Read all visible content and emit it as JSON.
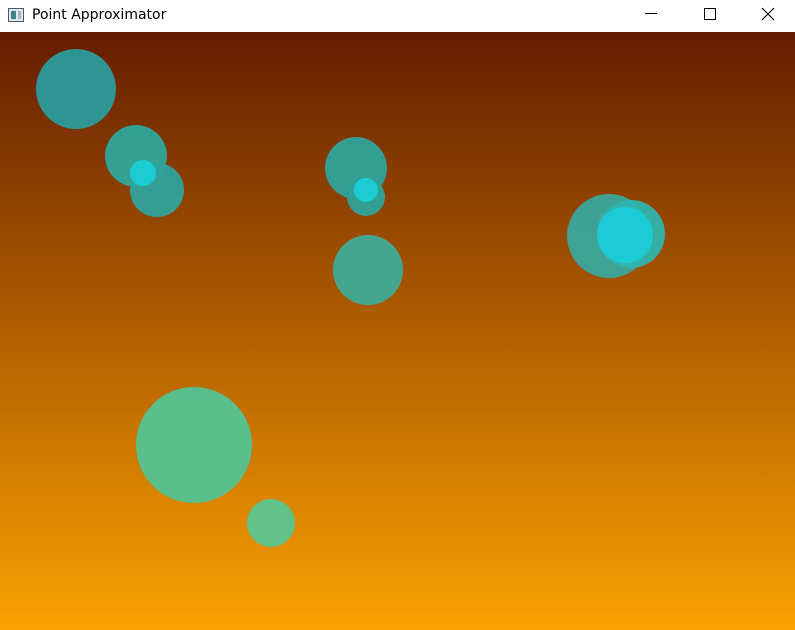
{
  "window": {
    "title": "Point Approximator",
    "icon": "app-window-icon",
    "controls": {
      "minimize": "minimize-icon",
      "maximize": "maximize-icon",
      "close": "close-icon"
    }
  },
  "canvas": {
    "background_gradient": {
      "top_color": "#651d00",
      "bottom_color": "#fba100"
    },
    "circle_colors": {
      "teal": "#2aa39c",
      "green": "#53c392",
      "cyan": "#1ad1d8"
    }
  }
}
